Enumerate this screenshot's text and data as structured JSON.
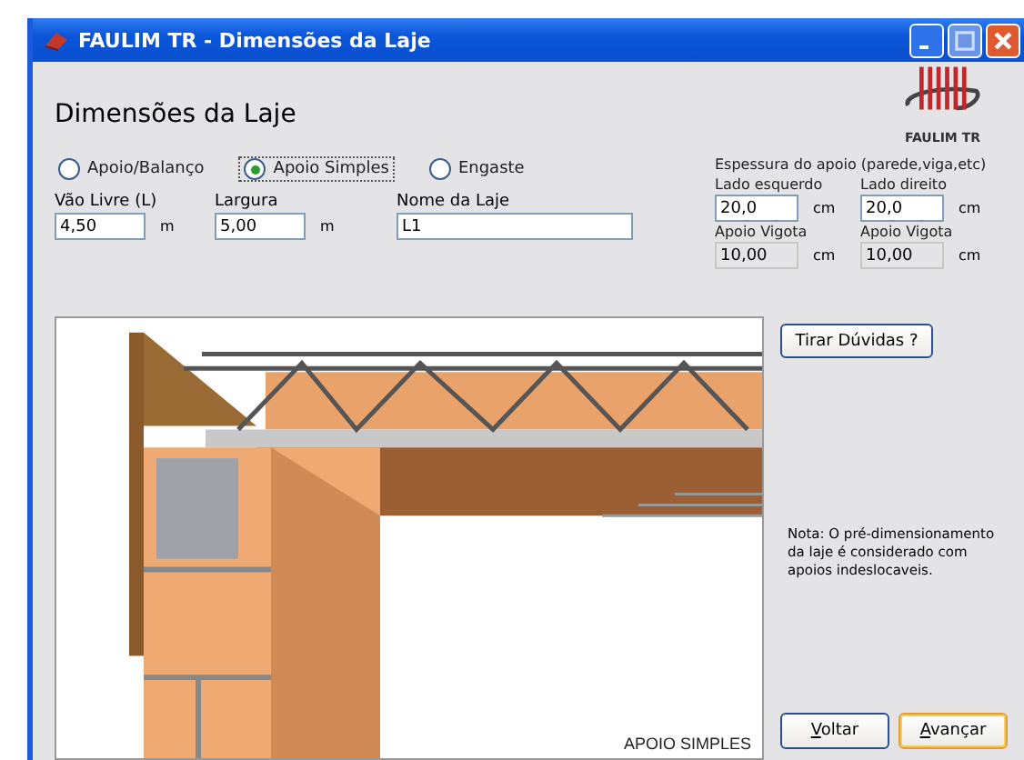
{
  "window": {
    "title": "FAULIM TR - Dimensões da Laje"
  },
  "heading": "Dimensões da Laje",
  "logo": {
    "text": "FAULIM TR"
  },
  "support_types": [
    {
      "label": "Apoio/Balanço",
      "selected": false
    },
    {
      "label": "Apoio Simples",
      "selected": true
    },
    {
      "label": "Engaste",
      "selected": false
    }
  ],
  "fields": [
    {
      "label": "Vão Livre (L)",
      "value": "4,50",
      "unit": "m",
      "kind": "short"
    },
    {
      "label": "Largura",
      "value": "5,00",
      "unit": "m",
      "kind": "short"
    },
    {
      "label": "Nome da Laje",
      "value": "L1",
      "kind": "wide"
    }
  ],
  "support_thickness": {
    "title": "Espessura do apoio (parede,viga,etc)",
    "fields": [
      {
        "label": "Lado esquerdo",
        "value": "20,0",
        "unit": "cm",
        "disabled": false
      },
      {
        "label": "Lado direito",
        "value": "20,0",
        "unit": "cm",
        "disabled": false
      },
      {
        "label": "Apoio Vigota",
        "value": "10,00",
        "unit": "cm",
        "disabled": true
      },
      {
        "label": "Apoio Vigota",
        "value": "10,00",
        "unit": "cm",
        "disabled": true
      }
    ]
  },
  "illustration": {
    "caption": "APOIO SIMPLES"
  },
  "help_button": "Tirar Dúvidas ?",
  "note": "Nota: O pré-dimensionamento da laje é considerado com apoios indeslocaveis.",
  "buttons": [
    {
      "label": "Voltar",
      "kind": "normal"
    },
    {
      "label": "Avançar",
      "kind": "default"
    }
  ]
}
